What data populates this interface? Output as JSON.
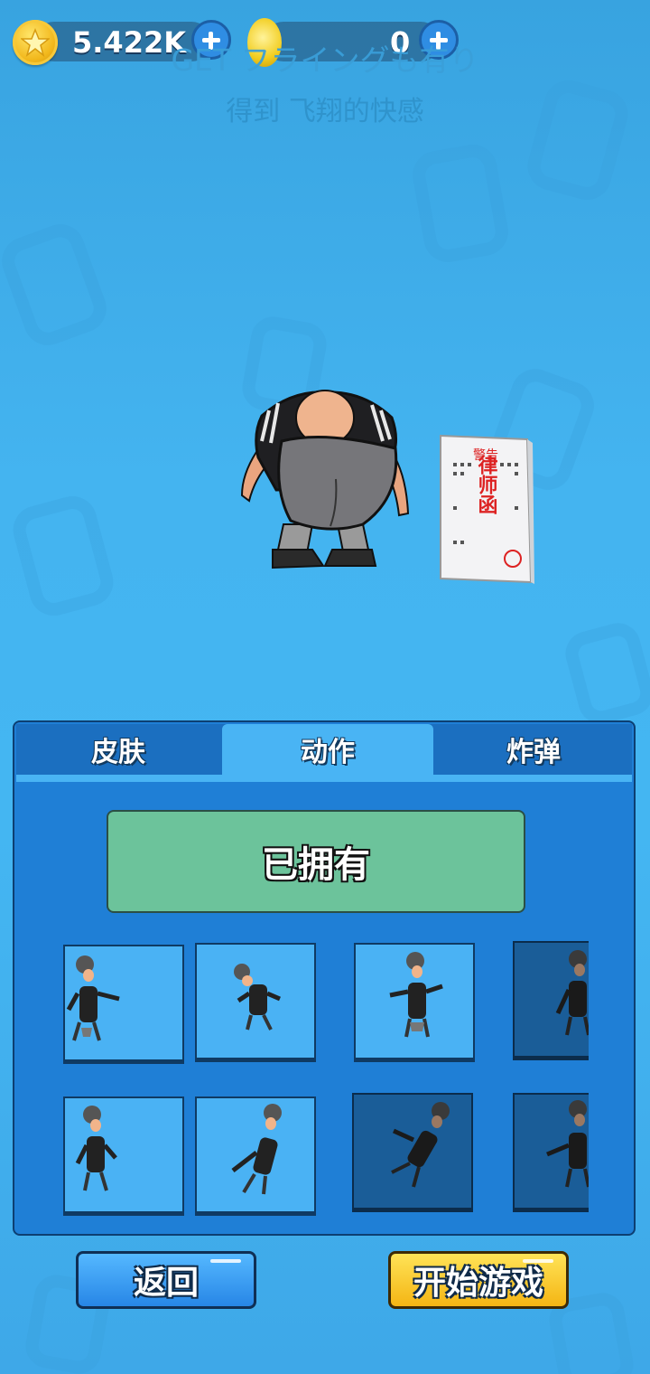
{
  "currency": {
    "coins": {
      "icon": "star-coin-icon",
      "value": "5.422K"
    },
    "gems": {
      "icon": "gold-egg-icon",
      "value": "0"
    }
  },
  "title": {
    "line1": "GET フライングも有り",
    "line2": "得到 飞翔的快感"
  },
  "preview": {
    "character_icon": "character-back-view",
    "item_icon": "lawyer-letter-icon",
    "letter_text": {
      "top": "警告",
      "main": "律师函"
    }
  },
  "tabs": [
    {
      "label": "皮肤",
      "active": false
    },
    {
      "label": "动作",
      "active": true
    },
    {
      "label": "炸弹",
      "active": false
    }
  ],
  "status_button": {
    "label": "已拥有"
  },
  "actions": [
    {
      "pose": "pose-1",
      "locked": false
    },
    {
      "pose": "pose-2",
      "locked": false
    },
    {
      "pose": "pose-3",
      "locked": false
    },
    {
      "pose": "pose-4",
      "locked": true
    },
    {
      "pose": "pose-5",
      "locked": false
    },
    {
      "pose": "pose-6",
      "locked": false
    },
    {
      "pose": "pose-7",
      "locked": true
    },
    {
      "pose": "pose-8",
      "locked": true
    }
  ],
  "buttons": {
    "back": "返回",
    "start": "开始游戏"
  },
  "colors": {
    "background": "#44b4f0",
    "panel": "#1f7fd6",
    "tab_active": "#49b4f4",
    "owned": "#6cc39b",
    "start": "#f4b514"
  }
}
